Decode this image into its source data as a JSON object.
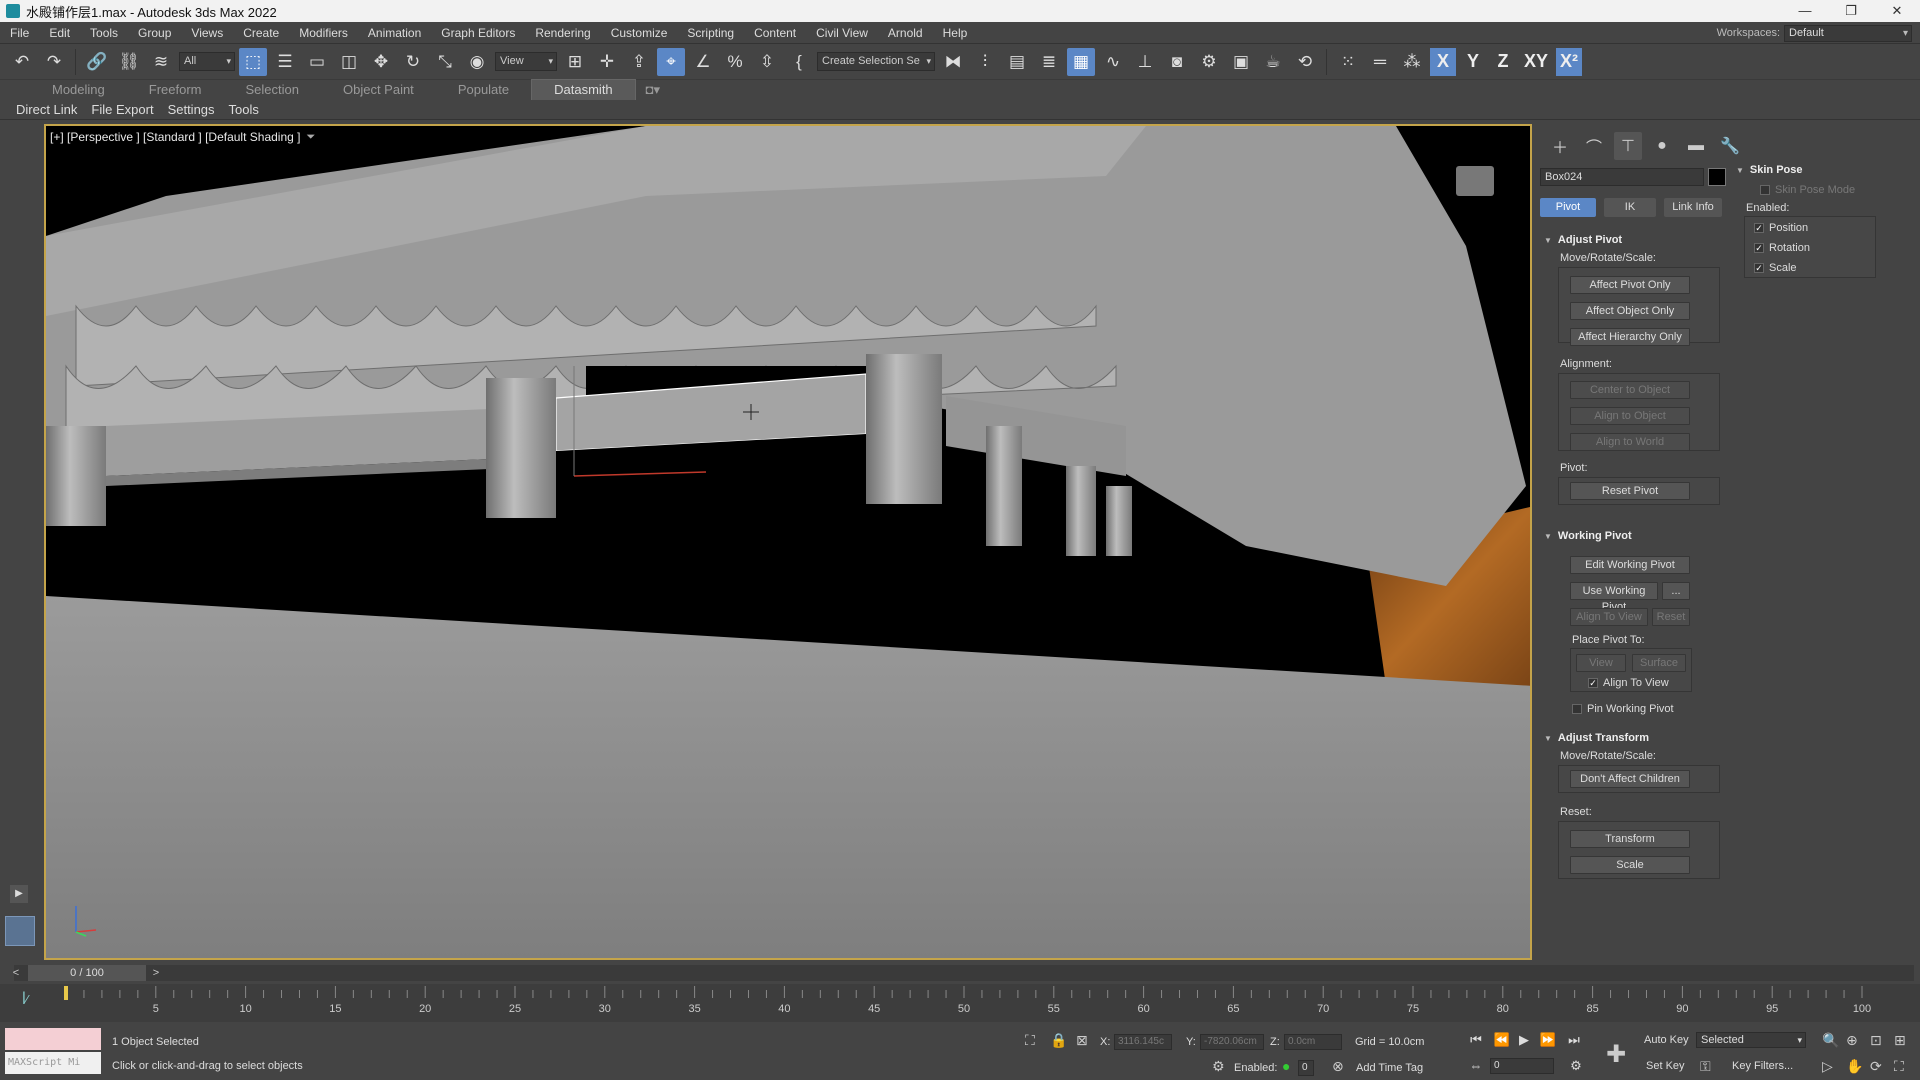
{
  "window": {
    "title": "水殿铺作层1.max - Autodesk 3ds Max 2022",
    "controls": [
      "—",
      "❐",
      "✕"
    ]
  },
  "menu": {
    "items": [
      "File",
      "Edit",
      "Tools",
      "Group",
      "Views",
      "Create",
      "Modifiers",
      "Animation",
      "Graph Editors",
      "Rendering",
      "Customize",
      "Scripting",
      "Content",
      "Civil View",
      "Arnold",
      "Help"
    ],
    "workspaces_label": "Workspaces:",
    "workspace_value": "Default"
  },
  "toolbar": {
    "selection_filter": "All",
    "ref_coord": "View",
    "named_selection": "Create Selection Se",
    "axis": [
      "X",
      "Y",
      "Z",
      "XY",
      "X²"
    ]
  },
  "ribbon": {
    "tabs": [
      "Modeling",
      "Freeform",
      "Selection",
      "Object Paint",
      "Populate",
      "Datasmith"
    ],
    "active_tab": "Datasmith"
  },
  "datasmith": {
    "items": [
      "Direct Link",
      "File Export",
      "Settings",
      "Tools"
    ]
  },
  "viewport": {
    "label": "[+] [Perspective ] [Standard ] [Default Shading ]"
  },
  "command_panel": {
    "object_name": "Box024",
    "object_color": "#000000",
    "subtabs": [
      "Pivot",
      "IK",
      "Link Info"
    ],
    "active_subtab": "Pivot",
    "adjust_pivot": {
      "title": "Adjust Pivot",
      "move_label": "Move/Rotate/Scale:",
      "buttons": [
        "Affect Pivot Only",
        "Affect Object Only",
        "Affect Hierarchy Only"
      ],
      "alignment_label": "Alignment:",
      "alignment_buttons": [
        "Center to Object",
        "Align to Object",
        "Align to World"
      ],
      "pivot_label": "Pivot:",
      "reset_pivot": "Reset Pivot"
    },
    "working_pivot": {
      "title": "Working Pivot",
      "edit": "Edit Working Pivot",
      "use": "Use Working Pivot",
      "use_more": "...",
      "align_to_view": "Align To View",
      "reset": "Reset",
      "place_label": "Place Pivot To:",
      "view": "View",
      "surface": "Surface",
      "align_check": "Align To View",
      "pin": "Pin Working Pivot"
    },
    "adjust_transform": {
      "title": "Adjust Transform",
      "move_label": "Move/Rotate/Scale:",
      "dont_affect": "Don't Affect Children",
      "reset_label": "Reset:",
      "transform": "Transform",
      "scale": "Scale"
    },
    "skin_pose": {
      "title": "Skin Pose",
      "mode": "Skin Pose Mode",
      "enabled_label": "Enabled:",
      "position": "Position",
      "rotation": "Rotation",
      "scale": "Scale"
    }
  },
  "timeline": {
    "frame_display": "0 / 100",
    "ticks": [
      "5",
      "10",
      "15",
      "20",
      "25",
      "30",
      "35",
      "40",
      "45",
      "50",
      "55",
      "60",
      "65",
      "70",
      "75",
      "80",
      "85",
      "90",
      "95",
      "100"
    ]
  },
  "status": {
    "maxscript": "MAXScript Mi",
    "selected": "1 Object Selected",
    "prompt": "Click or click-and-drag to select objects",
    "x_label": "X:",
    "x_value": "3116.145c",
    "y_label": "Y:",
    "y_value": "-7820.06cm",
    "z_label": "Z:",
    "z_value": "0.0cm",
    "grid": "Grid = 10.0cm",
    "enabled": "Enabled:",
    "enabled_value": "0",
    "add_time_tag": "Add Time Tag",
    "auto_key": "Auto Key",
    "set_key": "Set Key",
    "key_mode": "Selected",
    "key_filters": "Key Filters...",
    "frame_value": "0"
  }
}
